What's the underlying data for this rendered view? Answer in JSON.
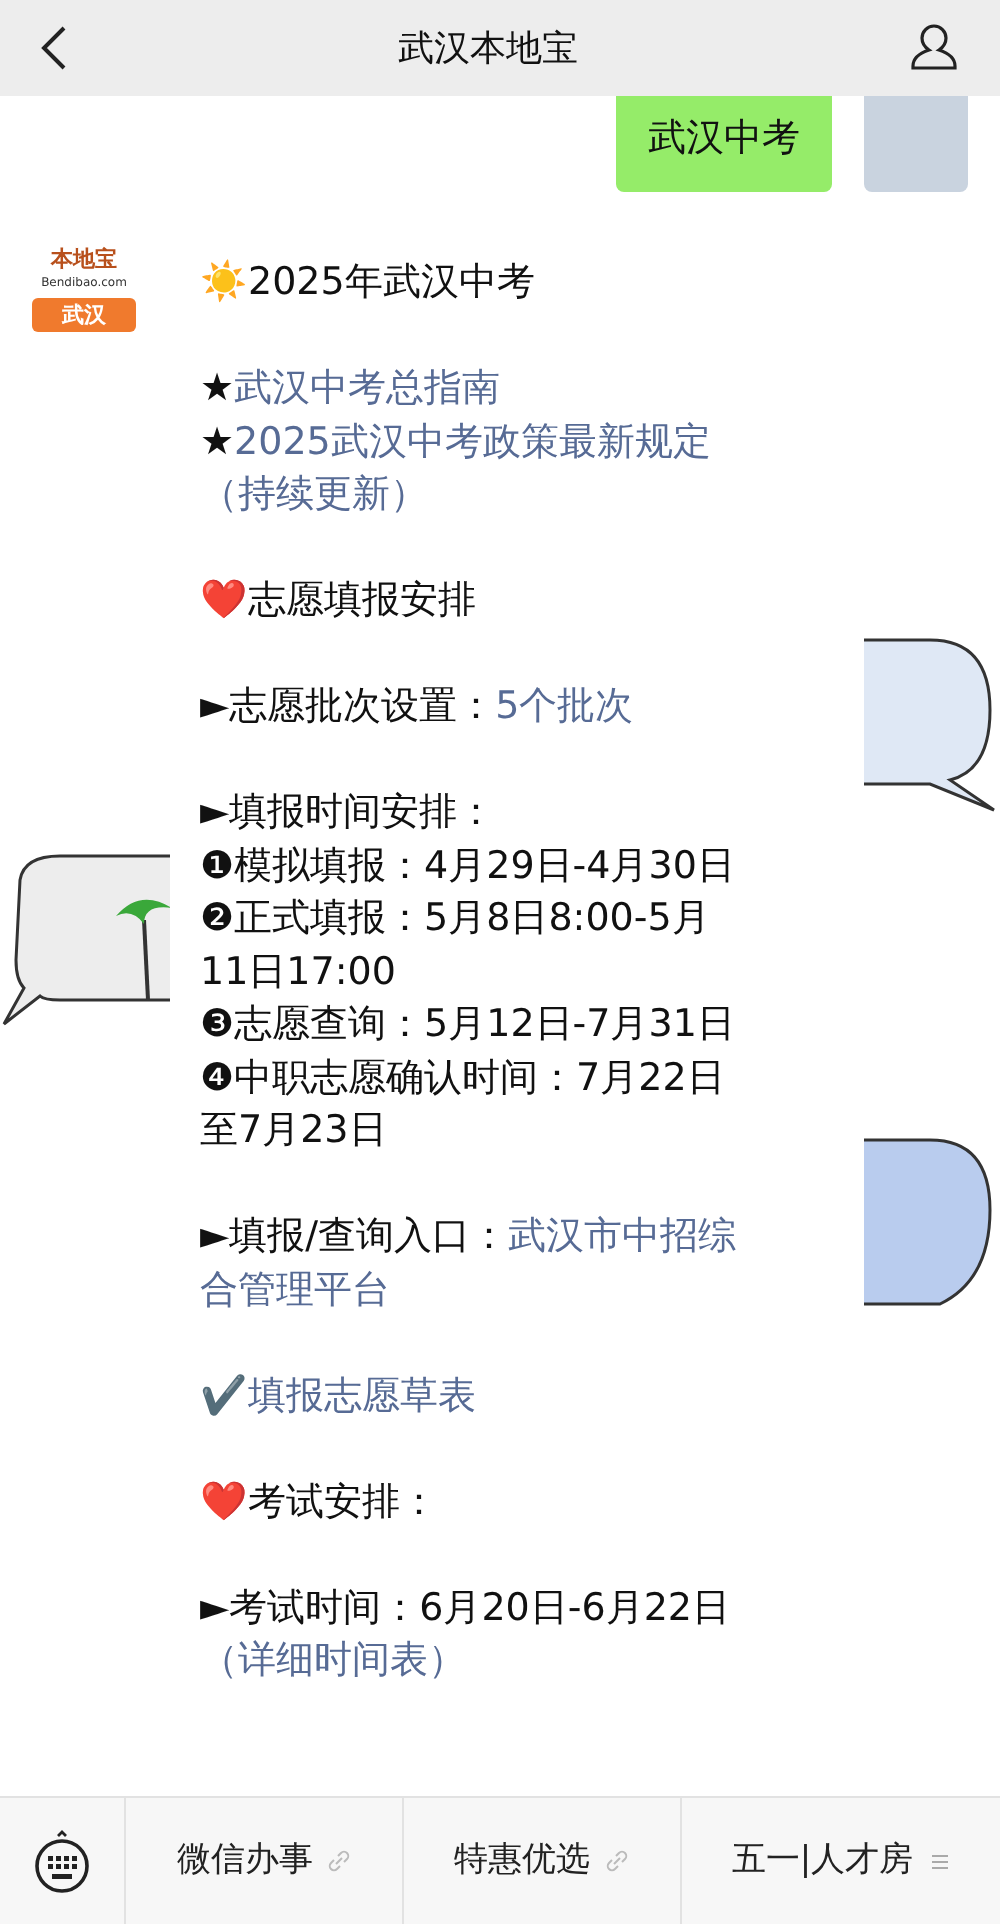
{
  "header": {
    "title": "武汉本地宝"
  },
  "user_message": {
    "text": "武汉中考"
  },
  "bot": {
    "logo": {
      "name": "本地宝",
      "site": "Bendibao.com",
      "city": "武汉"
    }
  },
  "message": {
    "blocks": [
      {
        "lines": [
          [
            {
              "kind": "text",
              "text": "☀️2025年武汉中考"
            }
          ]
        ]
      },
      {
        "lines": [
          [
            {
              "kind": "text",
              "text": "★"
            },
            {
              "kind": "link",
              "text": "武汉中考总指南"
            }
          ],
          [
            {
              "kind": "text",
              "text": "★"
            },
            {
              "kind": "link",
              "text": "2025武汉中考政策最新规定"
            }
          ],
          [
            {
              "kind": "link",
              "text": "（持续更新）"
            }
          ]
        ]
      },
      {
        "lines": [
          [
            {
              "kind": "text",
              "text": "❤️志愿填报安排"
            }
          ]
        ]
      },
      {
        "lines": [
          [
            {
              "kind": "text",
              "text": "►志愿批次设置："
            },
            {
              "kind": "link",
              "text": "5个批次"
            }
          ]
        ]
      },
      {
        "lines": [
          [
            {
              "kind": "text",
              "text": "►填报时间安排："
            }
          ],
          [
            {
              "kind": "text",
              "text": "❶模拟填报：4月29日-4月30日"
            }
          ],
          [
            {
              "kind": "text",
              "text": "❷正式填报：5月8日8:00-5月"
            }
          ],
          [
            {
              "kind": "text",
              "text": "11日17:00"
            }
          ],
          [
            {
              "kind": "text",
              "text": "❸志愿查询：5月12日-7月31日"
            }
          ],
          [
            {
              "kind": "text",
              "text": "❹中职志愿确认时间：7月22日"
            }
          ],
          [
            {
              "kind": "text",
              "text": "至7月23日"
            }
          ]
        ]
      },
      {
        "lines": [
          [
            {
              "kind": "text",
              "text": "►填报/查询入口："
            },
            {
              "kind": "link",
              "text": "武汉市中招综"
            }
          ],
          [
            {
              "kind": "link",
              "text": "合管理平台"
            }
          ]
        ]
      },
      {
        "lines": [
          [
            {
              "kind": "text",
              "text": "✔️"
            },
            {
              "kind": "link",
              "text": "填报志愿草表"
            }
          ]
        ]
      },
      {
        "lines": [
          [
            {
              "kind": "text",
              "text": "❤️考试安排："
            }
          ]
        ]
      },
      {
        "lines": [
          [
            {
              "kind": "text",
              "text": "►考试时间：6月20日-6月22日"
            }
          ],
          [
            {
              "kind": "link",
              "text": "（详细时间表）"
            }
          ]
        ]
      }
    ]
  },
  "menu": [
    {
      "label": "微信办事",
      "kind": "link"
    },
    {
      "label": "特惠优选",
      "kind": "link"
    },
    {
      "label": "五一|人才房",
      "kind": "submenu"
    }
  ]
}
